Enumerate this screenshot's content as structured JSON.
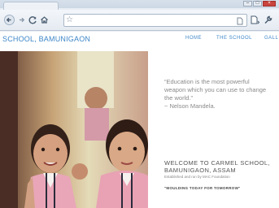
{
  "browser": {
    "nav_icons": {
      "back": "arrow-left-icon",
      "forward": "arrow-right-icon",
      "reload": "reload-icon",
      "home": "home-icon",
      "bookmark": "star-icon",
      "page_menu": "page-icon",
      "tools_menu": "wrench-icon"
    },
    "window_controls": {
      "minimize": "–",
      "maximize": "□",
      "close": "×"
    }
  },
  "site": {
    "brand": "SCHOOL, BAMUNIGAON",
    "nav": [
      "HOME",
      "THE SCHOOL",
      "GALL"
    ],
    "accent_color": "#3d86c8",
    "quote_lines": [
      "“Education is the most powerful",
      "weapon which you can use to change",
      "the world.”"
    ],
    "quote_attribution": "~ Nelson Mandela.",
    "welcome_lines": [
      "WELCOME TO CARMEL SCHOOL,",
      "BAMUNIGAON, ASSAM"
    ],
    "established": "Established and run by MAC Foundation",
    "motto": "\"MOULDING TODAY FOR TOMORROW\""
  }
}
